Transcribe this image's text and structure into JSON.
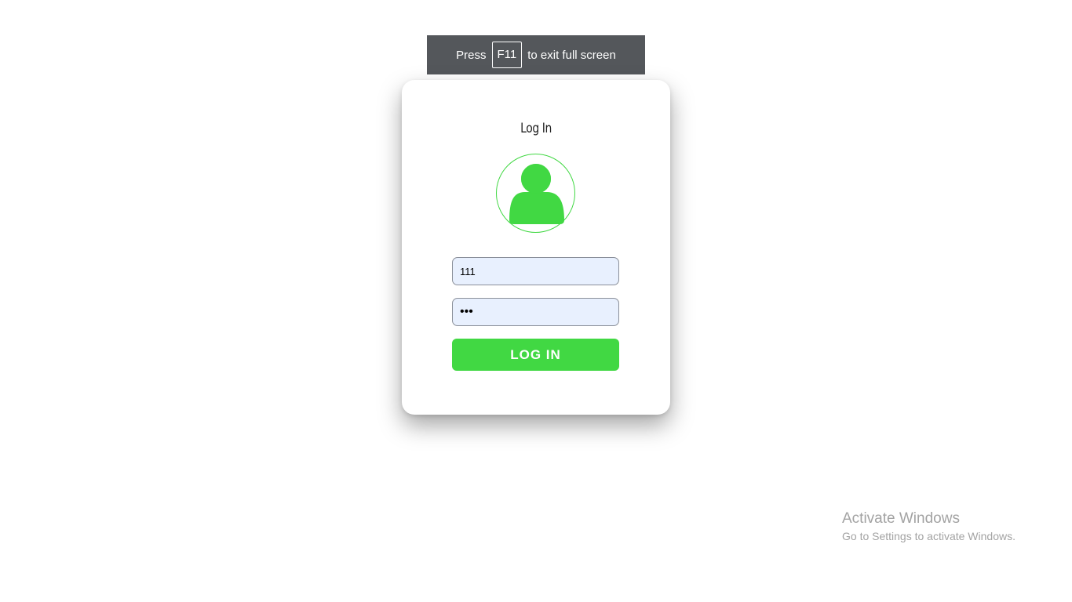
{
  "fullscreen_notice": {
    "prefix": "Press",
    "key": "F11",
    "suffix": "to exit full screen"
  },
  "login_card": {
    "title": "Log In",
    "avatar_icon": "user-icon",
    "accent_color": "#41d843",
    "username_value": "111",
    "password_value": "•••",
    "submit_label": "LOG IN"
  },
  "watermark": {
    "title": "Activate Windows",
    "subtitle": "Go to Settings to activate Windows."
  }
}
